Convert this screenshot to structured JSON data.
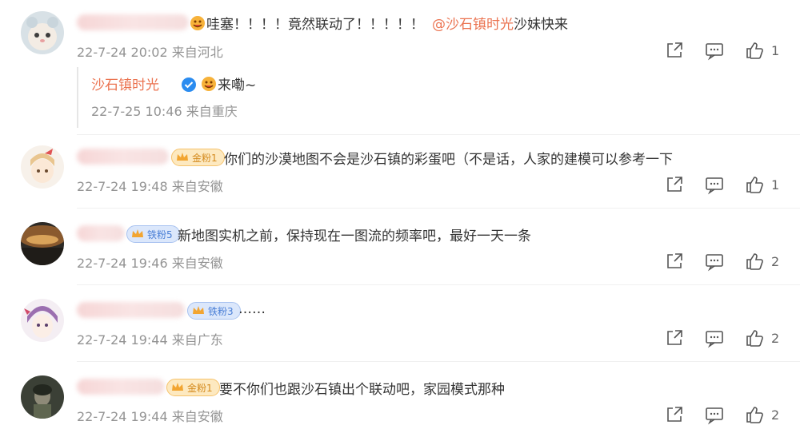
{
  "comments": [
    {
      "text_prefix": "哇塞！！！！竟然联动了！！！！！",
      "mention": "@沙石镇时光",
      "text_suffix": " 沙妹快来",
      "meta": "22-7-24 20:02 来自河北",
      "likes": "1",
      "reply": {
        "name": "沙石镇时光",
        "text": "来嘞~",
        "meta": "22-7-25 10:46 来自重庆"
      }
    },
    {
      "badge": "金粉1",
      "text": "你们的沙漠地图不会是沙石镇的彩蛋吧（不是话，人家的建模可以参考一下",
      "meta": "22-7-24 19:48 来自安徽",
      "likes": "1"
    },
    {
      "badge": "铁粉5",
      "text": "新地图实机之前，保持现在一图流的频率吧，最好一天一条",
      "meta": "22-7-24 19:46 来自安徽",
      "likes": "2"
    },
    {
      "badge": "铁粉3",
      "text": "……",
      "meta": "22-7-24 19:44 来自广东",
      "likes": "2"
    },
    {
      "badge": "金粉1",
      "text": "要不你们也跟沙石镇出个联动吧，家园模式那种",
      "meta": "22-7-24 19:44 来自安徽",
      "likes": "2"
    }
  ],
  "icons": {
    "share": "share-icon",
    "comment": "comment-icon",
    "like": "like-icon"
  }
}
